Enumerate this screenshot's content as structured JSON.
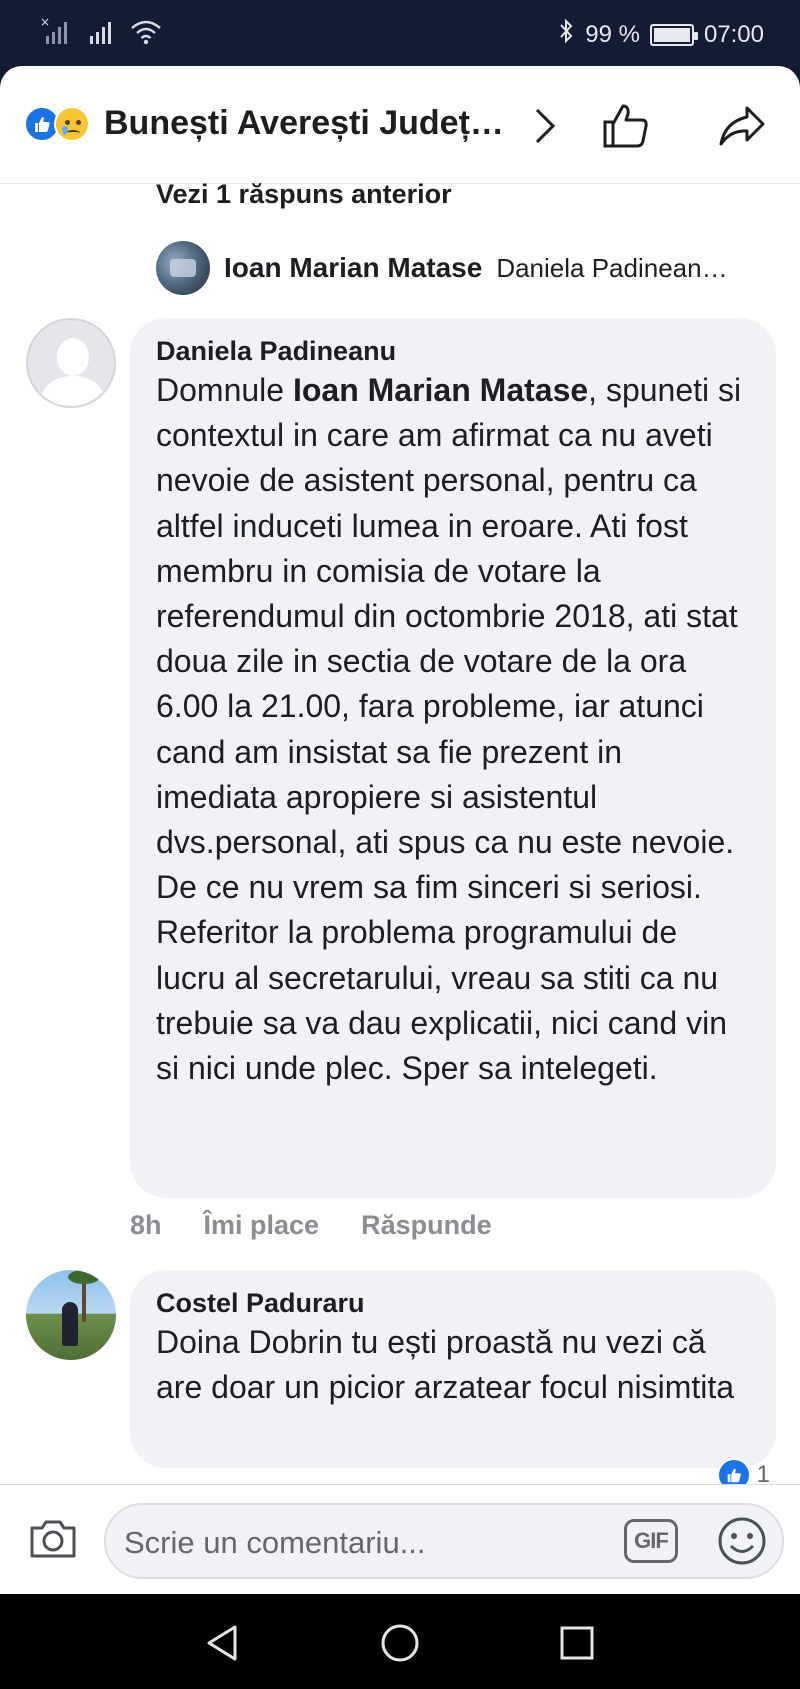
{
  "status_bar": {
    "battery_text": "99 %",
    "time": "07:00",
    "battery_level": 0.99,
    "icons": [
      "no-signal-icon",
      "signal-icon",
      "wifi-icon",
      "bluetooth-icon",
      "battery-icon"
    ]
  },
  "header": {
    "reactions": [
      "like-reaction-icon",
      "sad-reaction-icon"
    ],
    "title": "Bunești Averești Județ…",
    "icons": [
      "chevron-right-icon",
      "thumbs-up-icon",
      "share-icon"
    ]
  },
  "thread": {
    "previous_replies_label": "Vezi 1 răspuns anterior",
    "reply_preview": {
      "author": "Ioan Marian Matase",
      "snippet": "Daniela Padinean…"
    }
  },
  "comments": [
    {
      "author": "Daniela Padineanu",
      "mention": "Ioan Marian Matase",
      "text_before": "Domnule ",
      "text_after": ", spuneti si contextul in care am afirmat ca nu aveti nevoie de asistent personal, pentru ca altfel induceti lumea in eroare. Ati fost membru in comisia de votare la referendumul din octombrie 2018, ati stat doua zile in sectia de votare de la ora 6.00 la 21.00, fara probleme, iar atunci cand am insistat sa fie prezent in imediata apropiere si asistentul dvs.personal, ati spus ca nu este nevoie. De ce nu vrem sa fim sinceri si seriosi. Referitor la problema programului de lucru al secretarului, vreau sa stiti ca nu trebuie sa va dau explicatii, nici cand vin si nici unde plec. Sper sa intelegeti.",
      "time": "8h",
      "like_label": "Îmi place",
      "reply_label": "Răspunde"
    },
    {
      "author": "Costel Paduraru",
      "text": "Doina Dobrin tu ești proastă nu vezi că are doar un picior arzatear focul nisimtita",
      "reaction_count": "1"
    }
  ],
  "composer": {
    "placeholder": "Scrie un comentariu...",
    "gif_label": "GIF",
    "icons": [
      "camera-icon",
      "emoji-icon"
    ]
  },
  "navigation": {
    "icons": [
      "back-icon",
      "home-icon",
      "recents-icon"
    ]
  }
}
